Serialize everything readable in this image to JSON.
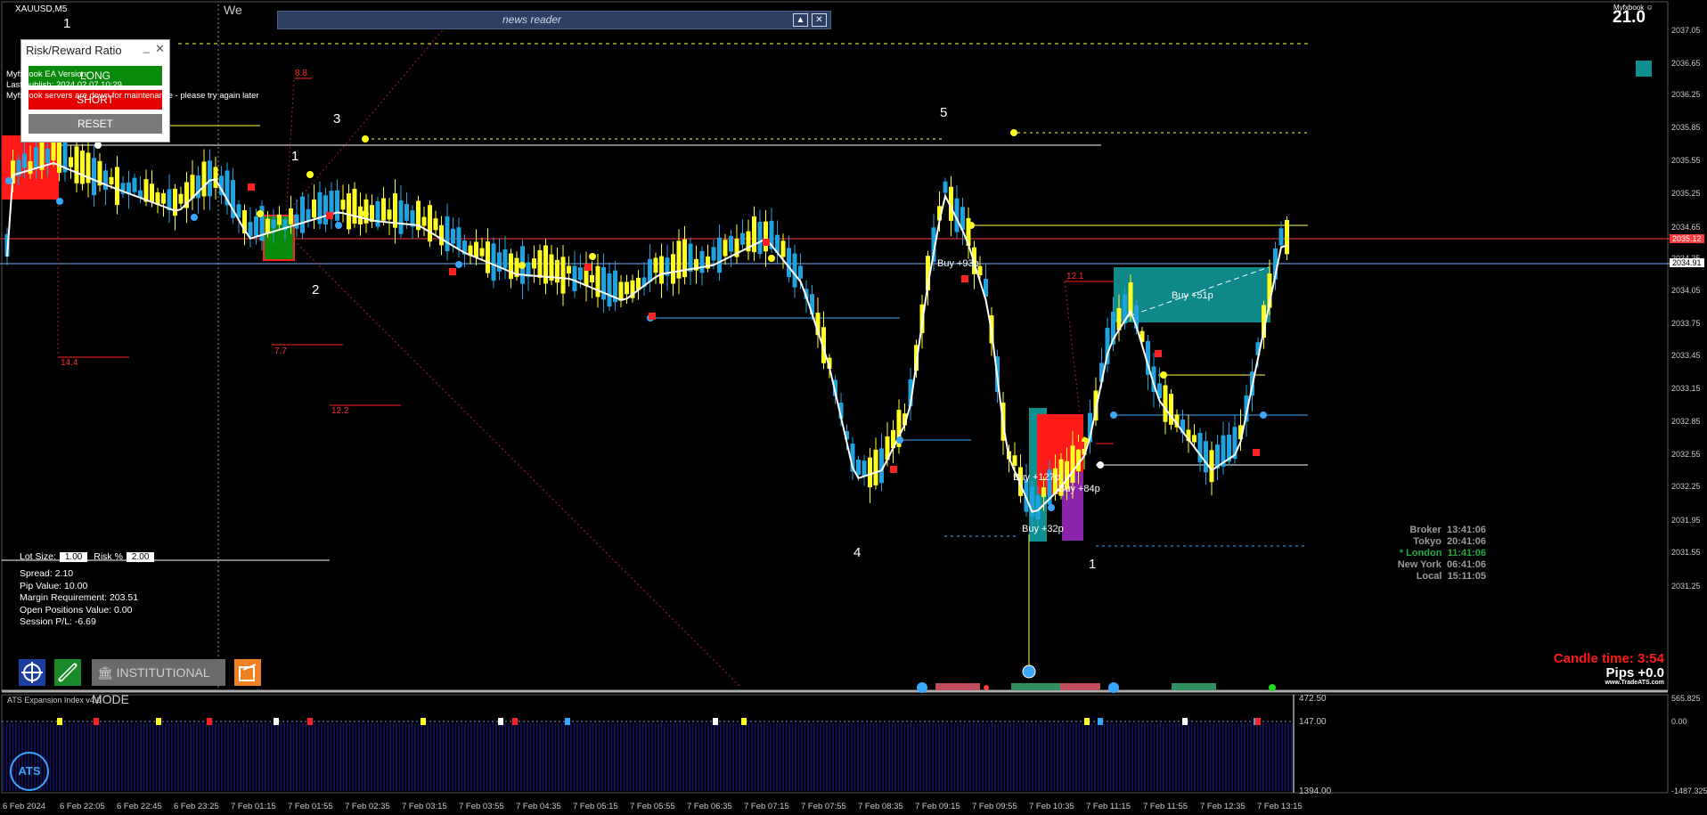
{
  "chart": {
    "symbol": "XAUUSD,M5",
    "top_label": "We",
    "spread_value_top": "21.0",
    "brand_top": "Myfxbook"
  },
  "news_reader": {
    "title": "news reader",
    "collapse_icon": "triangle-up-icon",
    "close_icon": "close-icon"
  },
  "rr_panel": {
    "title": "Risk/Reward Ratio",
    "long_label": "LONG",
    "short_label": "SHORT",
    "reset_label": "RESET",
    "colors": {
      "long": "#0a8a0a",
      "short": "#e60000",
      "reset": "#7a7a7a"
    }
  },
  "overlay_text": {
    "ea_version": "Myfxbook EA Version:",
    "last_publish": "Last publish: 2024.02.07 10:29",
    "server_msg": "Myfxbook servers are down for maintenance - please try again later"
  },
  "lot": {
    "lot_label": "Lot Size:",
    "lot_value": "1.00",
    "risk_label": "Risk %",
    "risk_value": "2.00"
  },
  "stats": [
    "Spread: 2.10",
    "Pip Value: 10.00",
    "Margin Requirement: 203.51",
    "Open Positions Value: 0.00",
    "Session P/L: -6.69"
  ],
  "clocks": [
    {
      "city": "Broker",
      "time": "13:41:06",
      "color": "#9a9a9a"
    },
    {
      "city": "Tokyo",
      "time": "20:41:06",
      "color": "#9a9a9a"
    },
    {
      "city": "* London",
      "time": "11:41:06",
      "color": "#22aa44"
    },
    {
      "city": "New York",
      "time": "06:41:06",
      "color": "#9a9a9a"
    },
    {
      "city": "Local",
      "time": "15:11:05",
      "color": "#9a9a9a"
    }
  ],
  "candle_time": "Candle time:  3:54",
  "pips": "Pips +0.0",
  "site": "www.TradeATS.com",
  "institutional_mode": "INSTITUTIONAL MODE",
  "price_axis": [
    "2037.05",
    "2036.65",
    "2036.25",
    "2035.85",
    "2035.55",
    "2035.25",
    "2034.65",
    "2034.35",
    "2034.05",
    "2033.75",
    "2033.45",
    "2033.15",
    "2032.85",
    "2032.55",
    "2032.25",
    "2031.95",
    "2031.55",
    "2031.25"
  ],
  "price_tags": {
    "red": "2035.12",
    "blue": "2034.91"
  },
  "time_axis": [
    "6 Feb 2024",
    "6 Feb 22:05",
    "6 Feb 22:45",
    "6 Feb 23:25",
    "7 Feb 01:15",
    "7 Feb 01:55",
    "7 Feb 02:35",
    "7 Feb 03:15",
    "7 Feb 03:55",
    "7 Feb 04:35",
    "7 Feb 05:15",
    "7 Feb 05:55",
    "7 Feb 06:35",
    "7 Feb 07:15",
    "7 Feb 07:55",
    "7 Feb 08:35",
    "7 Feb 09:15",
    "7 Feb 09:55",
    "7 Feb 10:35",
    "7 Feb 11:15",
    "7 Feb 11:55",
    "7 Feb 12:35",
    "7 Feb 13:15"
  ],
  "wave_labels": [
    "1",
    "3",
    "1",
    "2",
    "5",
    "4",
    "1"
  ],
  "red_labels": [
    "8.8",
    "14.4",
    "7.7",
    "12.2",
    "12.1"
  ],
  "trade_labels": [
    "Buy +93p",
    "Buy +51p",
    "Buy +127p",
    "Buy +84p",
    "Buy +32p"
  ],
  "indicator": {
    "title": "ATS Expansion Index v4.0",
    "levels": [
      "472.50",
      "147.00",
      "1394.00"
    ],
    "right_axis": [
      "565.825",
      "0.00",
      "-1487.325"
    ],
    "logo": "ATS"
  }
}
